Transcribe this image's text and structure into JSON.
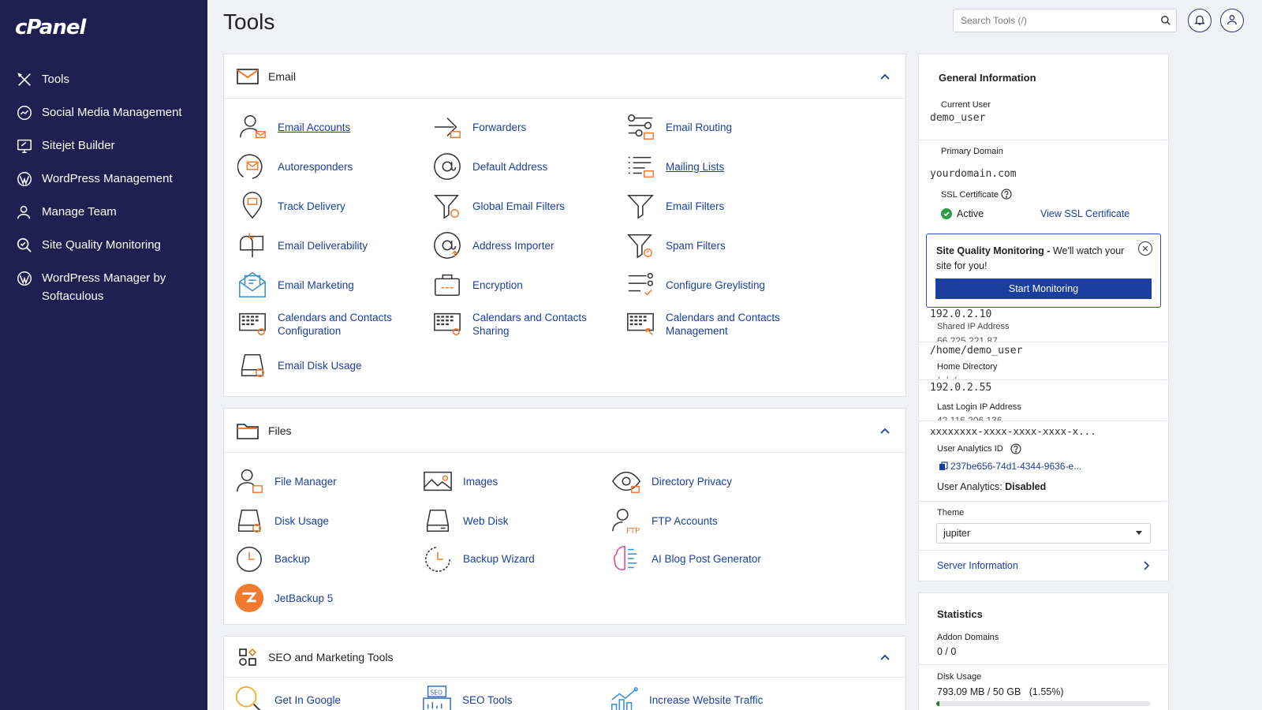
{
  "brand": {
    "logo": "cPanel"
  },
  "sidebar": {
    "items": [
      {
        "label": "Tools",
        "icon": "tools-icon"
      },
      {
        "label": "Social Media Management",
        "icon": "social-media-icon"
      },
      {
        "label": "Sitejet Builder",
        "icon": "sitejet-icon"
      },
      {
        "label": "WordPress Management",
        "icon": "wordpress-icon"
      },
      {
        "label": "Manage Team",
        "icon": "team-icon"
      },
      {
        "label": "Site Quality Monitoring",
        "icon": "site-quality-icon"
      },
      {
        "label": "WordPress Manager by Softaculous",
        "icon": "wordpress-icon"
      }
    ]
  },
  "header": {
    "title": "Tools",
    "search_placeholder": "Search Tools (/)"
  },
  "email": {
    "title": "Email",
    "tools": [
      "Email Accounts",
      "Forwarders",
      "Email Routing",
      "Autoresponders",
      "Default Address",
      "Mailing Lists",
      "Track Delivery",
      "Global Email Filters",
      "Email Filters",
      "Email Deliverability",
      "Address Importer",
      "Spam Filters",
      "Email Marketing",
      "Encryption",
      "Configure Greylisting",
      "Calendars and Contacts Configuration",
      "Calendars and Contacts Sharing",
      "Calendars and Contacts Management",
      "Email Disk Usage"
    ]
  },
  "files": {
    "title": "Files",
    "tools": [
      "File Manager",
      "Images",
      "Directory Privacy",
      "Disk Usage",
      "Web Disk",
      "FTP Accounts",
      "Backup",
      "Backup Wizard",
      "AI Blog Post Generator",
      "JetBackup 5"
    ]
  },
  "seo": {
    "title": "SEO and Marketing Tools",
    "tools": [
      "Get In Google",
      "SEO Tools",
      "Increase Website Traffic"
    ]
  },
  "general": {
    "title": "General Information",
    "current_user_label": "Current User",
    "current_user": "demo_user",
    "primary_domain_label": "Primary Domain",
    "primary_domain": "yourdomain.com",
    "ssl_label": "SSL Certificate",
    "ssl_status": "Active",
    "ssl_link": "View SSL Certificate",
    "sqm_bold": "Site Quality Monitoring -",
    "sqm_text": " We'll watch your site for you!",
    "sqm_button": "Start Monitoring",
    "shared_ip": "192.0.2.10",
    "shared_ip_label": "Shared IP Address",
    "shared_ip_hidden": "66.225.221.87",
    "home_dir": "/home/demo_user",
    "home_dir_label": "Home Directory",
    "last_login_ip": "192.0.2.55",
    "last_login_label": "Last Login IP Address",
    "last_login_hidden": "42.116.206.136",
    "analytics_id_mask": "xxxxxxxx-xxxx-xxxx-xxxx-x...",
    "analytics_id_label": "User Analytics ID",
    "analytics_id": "237be656-74d1-4344-9636-e...",
    "analytics_label": "User Analytics:",
    "analytics_value": "Disabled",
    "theme_label": "Theme",
    "theme_value": "jupiter",
    "server_info": "Server Information"
  },
  "statistics": {
    "title": "Statistics",
    "addon_label": "Addon Domains",
    "addon_value": "0 / 0",
    "disk_label": "Disk Usage",
    "disk_value": "793.09 MB / 50 GB   (1.55%)",
    "disk_percent": 1.55
  },
  "colors": {
    "sidebar": "#1e2051",
    "link": "#1a3f9e",
    "accent": "#f07b2e",
    "button": "#1b3fa0"
  }
}
